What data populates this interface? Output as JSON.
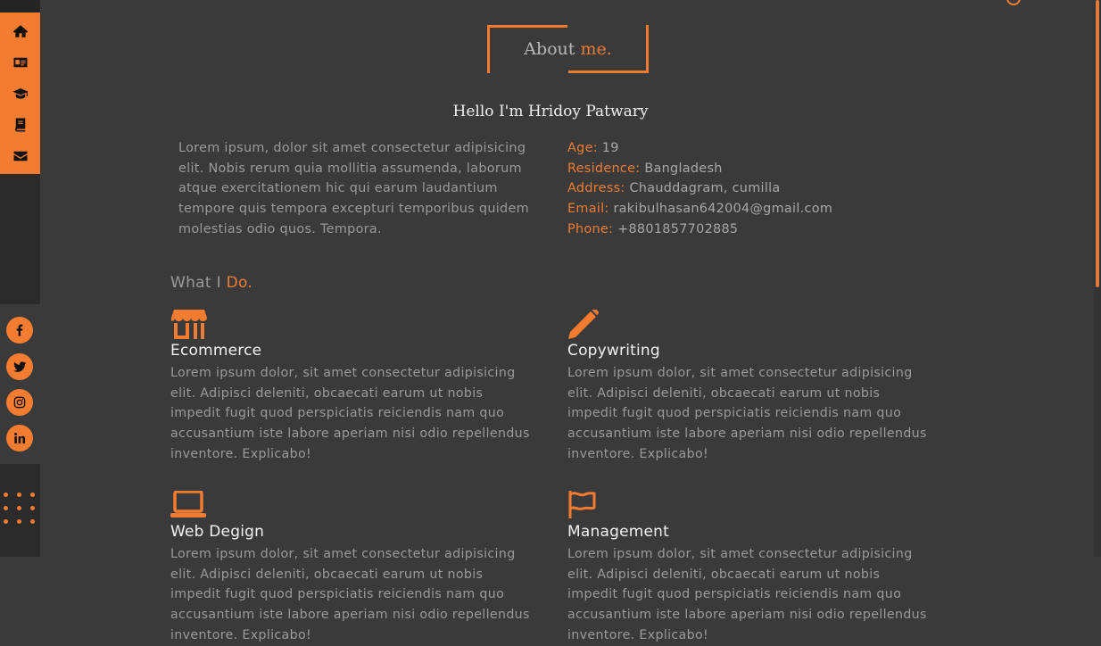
{
  "colors": {
    "accent": "#f47c30",
    "background": "#3a3a3a",
    "sidebar": "#2b2b2b"
  },
  "nav": {
    "items": [
      {
        "icon": "home-icon",
        "name": "home"
      },
      {
        "icon": "id-card-icon",
        "name": "about"
      },
      {
        "icon": "graduation-cap-icon",
        "name": "education"
      },
      {
        "icon": "book-icon",
        "name": "portfolio"
      },
      {
        "icon": "envelope-icon",
        "name": "contact"
      }
    ]
  },
  "socials": [
    {
      "icon": "facebook-icon"
    },
    {
      "icon": "twitter-icon"
    },
    {
      "icon": "instagram-icon"
    },
    {
      "icon": "linkedin-icon"
    }
  ],
  "about": {
    "title_plain": "About",
    "title_accent": "me.",
    "greeting": "Hello I'm Hridoy Patwary",
    "bio": "Lorem ipsum, dolor sit amet consectetur adipisicing elit. Nobis rerum quia mollitia assumenda, laborum atque exercitationem hic qui earum laudantium tempore quis tempora excepturi temporibus quidem molestias odio quos. Tempora.",
    "info": [
      {
        "label": "Age:",
        "value": "19"
      },
      {
        "label": "Residence:",
        "value": "Bangladesh"
      },
      {
        "label": "Address:",
        "value": "Chauddagram, cumilla"
      },
      {
        "label": "Email:",
        "value": "rakibulhasan642004@gmail.com"
      },
      {
        "label": "Phone:",
        "value": "+8801857702885"
      }
    ]
  },
  "services": {
    "heading_plain": "What I",
    "heading_accent": "Do.",
    "items": [
      {
        "icon": "store-icon",
        "title": "Ecommerce",
        "desc": "Lorem ipsum dolor, sit amet consectetur adipisicing elit. Adipisci deleniti, obcaecati earum ut nobis impedit fugit quod perspiciatis reiciendis nam quo accusantium iste labore aperiam nisi odio repellendus inventore. Explicabo!"
      },
      {
        "icon": "pencil-icon",
        "title": "Copywriting",
        "desc": "Lorem ipsum dolor, sit amet consectetur adipisicing elit. Adipisci deleniti, obcaecati earum ut nobis impedit fugit quod perspiciatis reiciendis nam quo accusantium iste labore aperiam nisi odio repellendus inventore. Explicabo!"
      },
      {
        "icon": "laptop-icon",
        "title": "Web Degign",
        "desc": "Lorem ipsum dolor, sit amet consectetur adipisicing elit. Adipisci deleniti, obcaecati earum ut nobis impedit fugit quod perspiciatis reiciendis nam quo accusantium iste labore aperiam nisi odio repellendus inventore. Explicabo!"
      },
      {
        "icon": "flag-icon",
        "title": "Management",
        "desc": "Lorem ipsum dolor, sit amet consectetur adipisicing elit. Adipisci deleniti, obcaecati earum ut nobis impedit fugit quod perspiciatis reiciendis nam quo accusantium iste labore aperiam nisi odio repellendus inventore. Explicabo!"
      }
    ]
  }
}
